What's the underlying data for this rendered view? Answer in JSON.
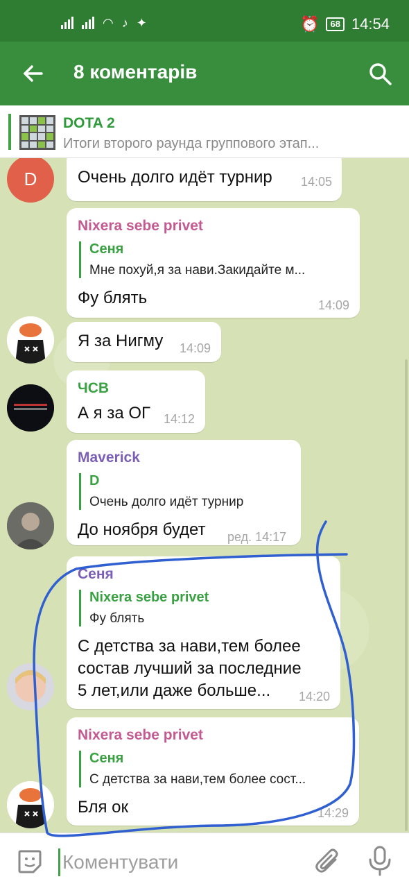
{
  "status_bar": {
    "time": "14:54",
    "battery": "68"
  },
  "app_bar": {
    "title": "8 коментарів"
  },
  "pinned": {
    "title": "DOTA 2",
    "subtitle": "Итоги второго раунда группового этап..."
  },
  "messages": [
    {
      "sender": "",
      "avatar_letter": "D",
      "text": "Очень долго идёт турнир",
      "time": "14:05"
    },
    {
      "sender": "Nixera sebe privet",
      "quote_author": "Сеня",
      "quote_text": "Мне похуй,я за нави.Закидайте м...",
      "text": "Фу блять",
      "time": "14:09"
    },
    {
      "sender": "",
      "text": "Я за Нигму",
      "time": "14:09"
    },
    {
      "sender": "ЧСВ",
      "text": "А я за ОГ",
      "time": "14:12"
    },
    {
      "sender": "Maverick",
      "quote_author": "D",
      "quote_text": "Очень долго идёт турнир",
      "text": "До ноября будет",
      "time": "ред. 14:17"
    },
    {
      "sender": "Сеня",
      "quote_author": "Nixera sebe privet",
      "quote_text": "Фу блять",
      "text_lines": [
        "С детства за нави,тем более",
        "состав лучший за последние",
        "5 лет,или даже больше..."
      ],
      "time": "14:20"
    },
    {
      "sender": "Nixera sebe privet",
      "quote_author": "Сеня",
      "quote_text": "С детства за нави,тем более сост...",
      "text": "Бля ок",
      "time": "14:29"
    }
  ],
  "composer": {
    "placeholder": "Коментувати"
  },
  "colors": {
    "status_bar": "#2e7d32",
    "app_bar": "#388e3c",
    "accent": "#43a047",
    "annotation": "#2f5fd0"
  }
}
